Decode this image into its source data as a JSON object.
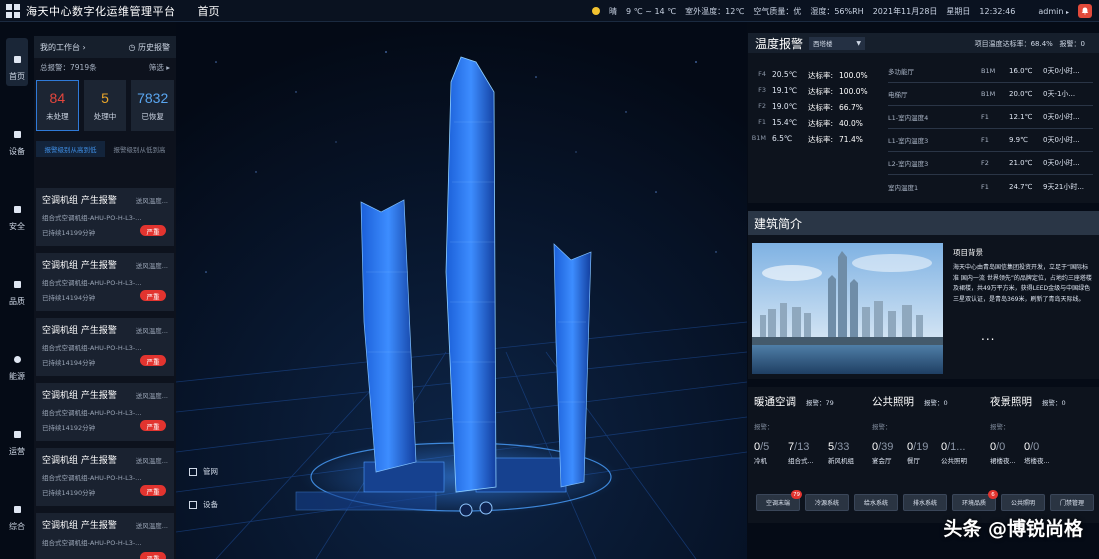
{
  "header": {
    "title": "海天中心数字化运维管理平台",
    "home": "首页",
    "weather": "晴",
    "temp_range": "9 ℃ ~ 14 ℃",
    "outdoor_temp": "室外温度：12℃",
    "air_quality": "空气质量：优",
    "humidity": "湿度：56%RH",
    "date": "2021年11月28日",
    "weekday": "星期日",
    "time": "12:32:46",
    "user": "admin",
    "bell_icon": "bell-icon"
  },
  "nav": {
    "items": [
      {
        "label": "首页",
        "icon": "home-icon",
        "active": true
      },
      {
        "label": "设备",
        "icon": "device-icon"
      },
      {
        "label": "安全",
        "icon": "shield-icon"
      },
      {
        "label": "品质",
        "icon": "quality-icon"
      },
      {
        "label": "能源",
        "icon": "energy-icon"
      },
      {
        "label": "运营",
        "icon": "operation-icon"
      },
      {
        "label": "综合",
        "icon": "stack-icon"
      }
    ]
  },
  "workbench": {
    "title": "我的工作台",
    "history": "历史报警",
    "total_label": "总报警：7919条",
    "filter": "筛选",
    "stats": [
      {
        "value": "84",
        "label": "未处理",
        "color": "#e5463d"
      },
      {
        "value": "5",
        "label": "处理中",
        "color": "#e8a52b"
      },
      {
        "value": "7832",
        "label": "已恢复",
        "color": "#5aa6f0"
      }
    ],
    "sort_tabs": [
      "报警级别从高到低",
      "报警级别从低到高"
    ],
    "alarms": [
      {
        "title": "空调机组 产生报警",
        "sub": "送风温度...",
        "device": "组合式空调机组-AHU-PO-H-L3-...",
        "time": "已持续14199分钟",
        "level": "严重"
      },
      {
        "title": "空调机组 产生报警",
        "sub": "送风温度...",
        "device": "组合式空调机组-AHU-PO-H-L3-...",
        "time": "已持续14194分钟",
        "level": "严重"
      },
      {
        "title": "空调机组 产生报警",
        "sub": "送风温度...",
        "device": "组合式空调机组-AHU-PO-H-L3-...",
        "time": "已持续14194分钟",
        "level": "严重"
      },
      {
        "title": "空调机组 产生报警",
        "sub": "送风温度...",
        "device": "组合式空调机组-AHU-PO-H-L3-...",
        "time": "已持续14192分钟",
        "level": "严重"
      },
      {
        "title": "空调机组 产生报警",
        "sub": "送风温度...",
        "device": "组合式空调机组-AHU-PO-H-L3-...",
        "time": "已持续14190分钟",
        "level": "严重"
      },
      {
        "title": "空调机组 产生报警",
        "sub": "送风温度...",
        "device": "组合式空调机组-AHU-PO-H-L3-...",
        "time": "",
        "level": "严重"
      }
    ]
  },
  "scene": {
    "legend": [
      {
        "label": "管网",
        "icon": "pipe-icon"
      },
      {
        "label": "设备",
        "icon": "device-icon"
      }
    ]
  },
  "temperature": {
    "title": "温度报警",
    "building": "西塔楼",
    "summary": "项目温度达标率：68.4%",
    "alarm_count": "报警：0",
    "floors": [
      {
        "floor": "F4",
        "temp": "20.5℃",
        "label": "达标率:",
        "rate": "100.0%"
      },
      {
        "floor": "F3",
        "temp": "19.1℃",
        "label": "达标率:",
        "rate": "100.0%"
      },
      {
        "floor": "F2",
        "temp": "19.0℃",
        "label": "达标率:",
        "rate": "66.7%"
      },
      {
        "floor": "F1",
        "temp": "15.4℃",
        "label": "达标率:",
        "rate": "40.0%"
      },
      {
        "floor": "B1M",
        "temp": "6.5℃",
        "label": "达标率:",
        "rate": "71.4%"
      }
    ],
    "zones": [
      {
        "name": "多功能厅",
        "floor": "B1M",
        "temp": "16.0℃",
        "status": "0天0小时..."
      },
      {
        "name": "电梯厅",
        "floor": "B1M",
        "temp": "20.0℃",
        "status": "0天-1小..."
      },
      {
        "name": "L1-室内温度4",
        "floor": "F1",
        "temp": "12.1℃",
        "status": "0天0小时..."
      },
      {
        "name": "L1-室内温度3",
        "floor": "F1",
        "temp": "9.9℃",
        "status": "0天0小时..."
      },
      {
        "name": "L2-室内温度3",
        "floor": "F2",
        "temp": "21.0℃",
        "status": "0天0小时..."
      },
      {
        "name": "室内温度1",
        "floor": "F1",
        "temp": "24.7℃",
        "status": "9天21小时..."
      }
    ]
  },
  "intro": {
    "title": "建筑简介",
    "bg_title": "项目背景",
    "text": "海天中心由青岛国信集团投资开发，立足于“国际标准 国内一流 世界领先”的品牌定位，占地约三座塔楼及裙楼，共49万平方米，获得LEED金级与中国绿色三星双认证，是青岛369米，刷新了青岛天际线。",
    "more": "..."
  },
  "systems": {
    "alarm_label": "报警：",
    "groups": [
      {
        "title": "暖通空调",
        "alarm": "报警：79"
      },
      {
        "title": "公共照明",
        "alarm": "报警：0"
      },
      {
        "title": "夜景照明",
        "alarm": "报警：0"
      }
    ],
    "metrics": [
      {
        "a": "0",
        "b": "/5",
        "label": "冷机"
      },
      {
        "a": "7",
        "b": "/13",
        "label": "组合式..."
      },
      {
        "a": "5",
        "b": "/33",
        "label": "新风机组"
      },
      {
        "a": "0",
        "b": "/39",
        "label": "宴会厅"
      },
      {
        "a": "0",
        "b": "/19",
        "label": "餐厅"
      },
      {
        "a": "0",
        "b": "/1...",
        "label": "公共照明"
      },
      {
        "a": "0",
        "b": "/0",
        "label": "裙楼夜..."
      },
      {
        "a": "0",
        "b": "/0",
        "label": "塔楼夜..."
      }
    ],
    "buttons": [
      {
        "label": "空调末端",
        "badge": "79"
      },
      {
        "label": "冷源系统",
        "badge": ""
      },
      {
        "label": "给水系统",
        "badge": ""
      },
      {
        "label": "排水系统",
        "badge": ""
      },
      {
        "label": "环境品质",
        "badge": "6"
      },
      {
        "label": "公共照明",
        "badge": ""
      },
      {
        "label": "门禁管理",
        "badge": ""
      }
    ]
  },
  "watermark": "头条 @博锐尚格"
}
